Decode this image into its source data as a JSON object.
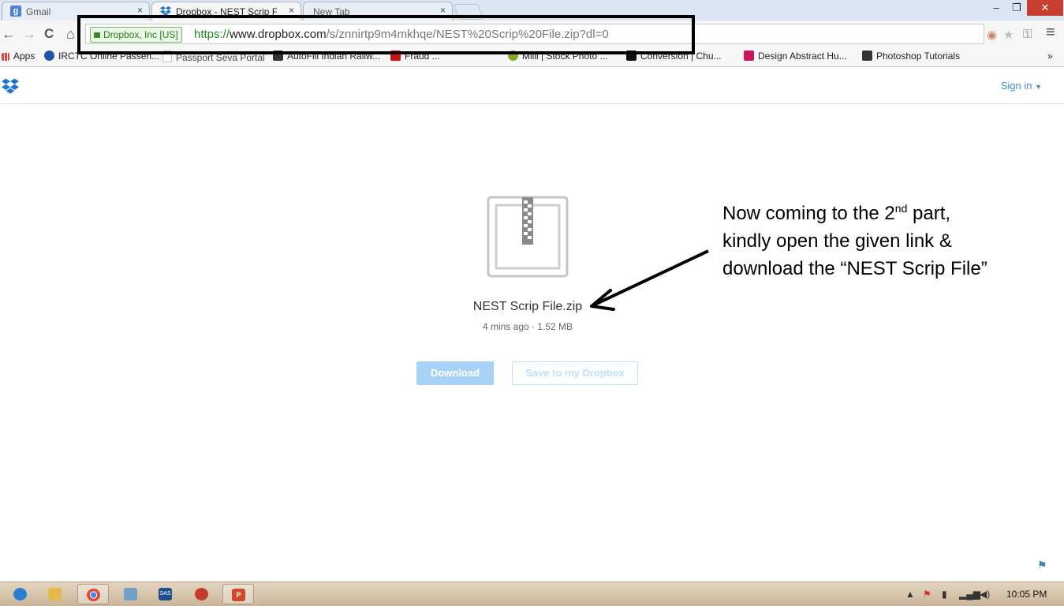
{
  "browser": {
    "tabs": [
      {
        "title": "Gmail",
        "favicon": "google-icon",
        "color": "#4a7fdc",
        "active": false
      },
      {
        "title": "Dropbox - NEST Scrip File",
        "favicon": "dropbox-icon",
        "color": "#1b75d0",
        "active": true
      },
      {
        "title": "New Tab",
        "favicon": "",
        "color": "",
        "active": false
      }
    ],
    "tab_close": "×",
    "window_controls": {
      "minimize": "–",
      "restore": "❐",
      "close": "✕"
    },
    "nav": {
      "back": "←",
      "forward": "→",
      "reload": "C",
      "home": "⌂"
    },
    "ev_label": "Dropbox, Inc [US]",
    "url": {
      "scheme": "https://",
      "host": "www.dropbox.com",
      "path": "/s/znnirtp9m4mkhqe/NEST%20Scrip%20File.zip?dl=0"
    },
    "menu_icon": "≡",
    "bookmarks_overflow": "»",
    "bookmarks": [
      {
        "label": "Apps",
        "icon": "apps-grid-icon",
        "color": "#d44"
      },
      {
        "label": "IRCTC Online Passen...",
        "icon": "irctc-icon",
        "color": "#2255aa"
      },
      {
        "label": "Passport Seva Portal",
        "icon": "page-icon",
        "color": "#bbbbbb"
      },
      {
        "label": "AutoFill Indian Railw...",
        "icon": "autofill-icon",
        "color": "#333333"
      },
      {
        "label": "Fraud ...",
        "icon": "youtube-icon",
        "color": "#cc1111"
      },
      {
        "label": "Milli | Stock Photo ...",
        "icon": "milli-icon",
        "color": "#88aa22"
      },
      {
        "label": "Conversion | Chu...",
        "icon": "conversion-icon",
        "color": "#111111"
      },
      {
        "label": "Design Abstract Hu...",
        "icon": "pv-icon",
        "color": "#c8175f"
      },
      {
        "label": "Photoshop Tutorials",
        "icon": "ps-icon",
        "color": "#333333"
      }
    ]
  },
  "page": {
    "signin": "Sign in",
    "file_name": "NEST Scrip File.zip",
    "file_meta": "4 mins ago · 1.52 MB",
    "download_label": "Download",
    "save_label": "Save to my Dropbox",
    "callout_line1_pre": "Now coming to the 2",
    "callout_sup": "nd",
    "callout_line1_post": " part,",
    "callout_line2": "kindly open the given link &",
    "callout_line3": "download the “NEST Scrip File”",
    "brand_color": "#3d8fd7"
  },
  "taskbar": {
    "items": [
      {
        "icon": "ie-icon",
        "color": "#2a7fd0",
        "active": false
      },
      {
        "icon": "explorer-icon",
        "color": "#e5b94a",
        "active": false
      },
      {
        "icon": "chrome-icon",
        "color": "#dd4b39",
        "active": true
      },
      {
        "icon": "notepad-icon",
        "color": "#6fa0c8",
        "active": false
      },
      {
        "icon": "sas-icon",
        "color": "#1f4f8f",
        "active": false
      },
      {
        "icon": "paint-icon",
        "color": "#c43b2b",
        "active": false
      },
      {
        "icon": "powerpoint-icon",
        "color": "#d24726",
        "active": true
      }
    ],
    "clock": "10:05 PM"
  }
}
